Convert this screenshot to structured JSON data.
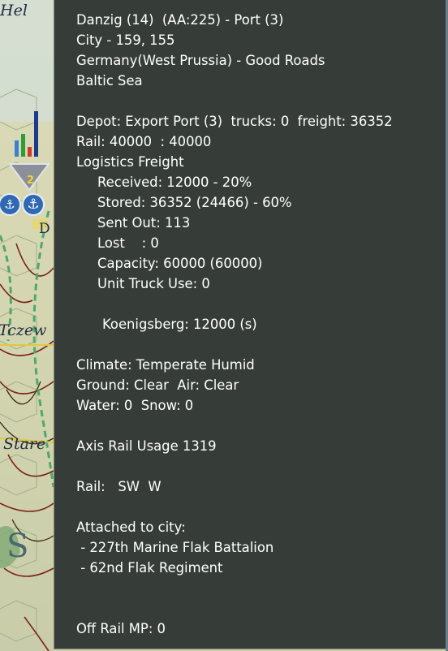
{
  "map": {
    "labels": {
      "hel": "Hel",
      "tczew": "Tczew",
      "stare": "Stare",
      "d_letter": "D",
      "region_letter": "S"
    }
  },
  "unit_counter": {
    "stack_count": "2",
    "icon": "anchor-icon",
    "bar_colors": [
      "#3a7fd0",
      "#2f9b3a",
      "#d33a2a",
      "#1d3b8a"
    ]
  },
  "tooltip": {
    "header": {
      "title": "Danzig (14)  (AA:225) - Port (3)",
      "city_coords": "City - 159, 155",
      "region": "Germany(West Prussia) - Good Roads",
      "sea": "Baltic Sea"
    },
    "depot": {
      "line": "Depot: Export Port (3)  trucks: 0  freight: 36352",
      "rail": "Rail: 40000  : 40000",
      "logistics_title": "Logistics Freight",
      "received": "Received: 12000 - 20%",
      "stored": "Stored: 36352 (24466) - 60%",
      "sent_out": "Sent Out: 113",
      "lost": "Lost    : 0",
      "capacity": "Capacity: 60000 (60000)",
      "unit_truck_use": "Unit Truck Use: 0",
      "koenigsberg": "Koenigsberg: 12000 (s)"
    },
    "weather": {
      "climate": "Climate: Temperate Humid",
      "ground_air": "Ground: Clear  Air: Clear",
      "water_snow": "Water: 0  Snow: 0"
    },
    "rail_usage": "Axis Rail Usage 1319",
    "rail_dirs": "Rail:   SW  W",
    "attached": {
      "title": "Attached to city:",
      "items": [
        " - 227th Marine Flak Battalion",
        " - 62nd Flak Regiment"
      ]
    },
    "off_rail": "Off Rail MP: 0"
  },
  "colors": {
    "panel_bg": "#363d38",
    "panel_border": "#7d8a6f",
    "text": "#ffffff"
  }
}
